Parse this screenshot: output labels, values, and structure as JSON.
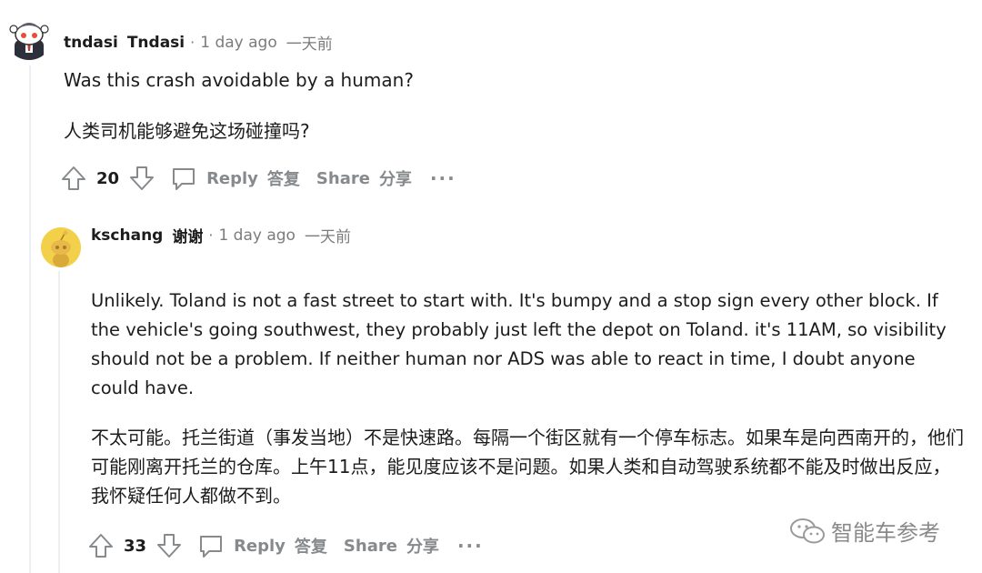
{
  "comments": [
    {
      "username": "tndasi",
      "flair": "Tndasi",
      "time": "1 day ago",
      "time_cn": "一天前",
      "body_en": "Was this crash avoidable by a human?",
      "body_cn": "人类司机能够避免这场碰撞吗?",
      "votes": "20",
      "reply_label": "Reply",
      "reply_cn": "答复",
      "share_label": "Share",
      "share_cn": "分享",
      "more_label": "···"
    },
    {
      "username": "kschang",
      "flair": "谢谢",
      "time": "1 day ago",
      "time_cn": "一天前",
      "body_en": "Unlikely. Toland is not a fast street to start with. It's bumpy and a stop sign every other block. If the vehicle's going southwest, they probably just left the depot on Toland. it's 11AM, so visibility should not be a problem. If neither human nor ADS was able to react in time, I doubt anyone could have.",
      "body_cn": "不太可能。托兰街道（事发当地）不是快速路。每隔一个街区就有一个停车标志。如果车是向西南开的，他们可能刚离开托兰的仓库。上午11点，能见度应该不是问题。如果人类和自动驾驶系统都不能及时做出反应，我怀疑任何人都做不到。",
      "votes": "33",
      "reply_label": "Reply",
      "reply_cn": "答复",
      "share_label": "Share",
      "share_cn": "分享",
      "more_label": "···"
    }
  ],
  "watermark": {
    "text": "智能车参考"
  },
  "colors": {
    "text": "#1c1c1c",
    "meta": "#7c7c7c",
    "action": "#878a8c",
    "thread_line": "#edeff1",
    "avatar2_bg": "#f3d04a"
  }
}
